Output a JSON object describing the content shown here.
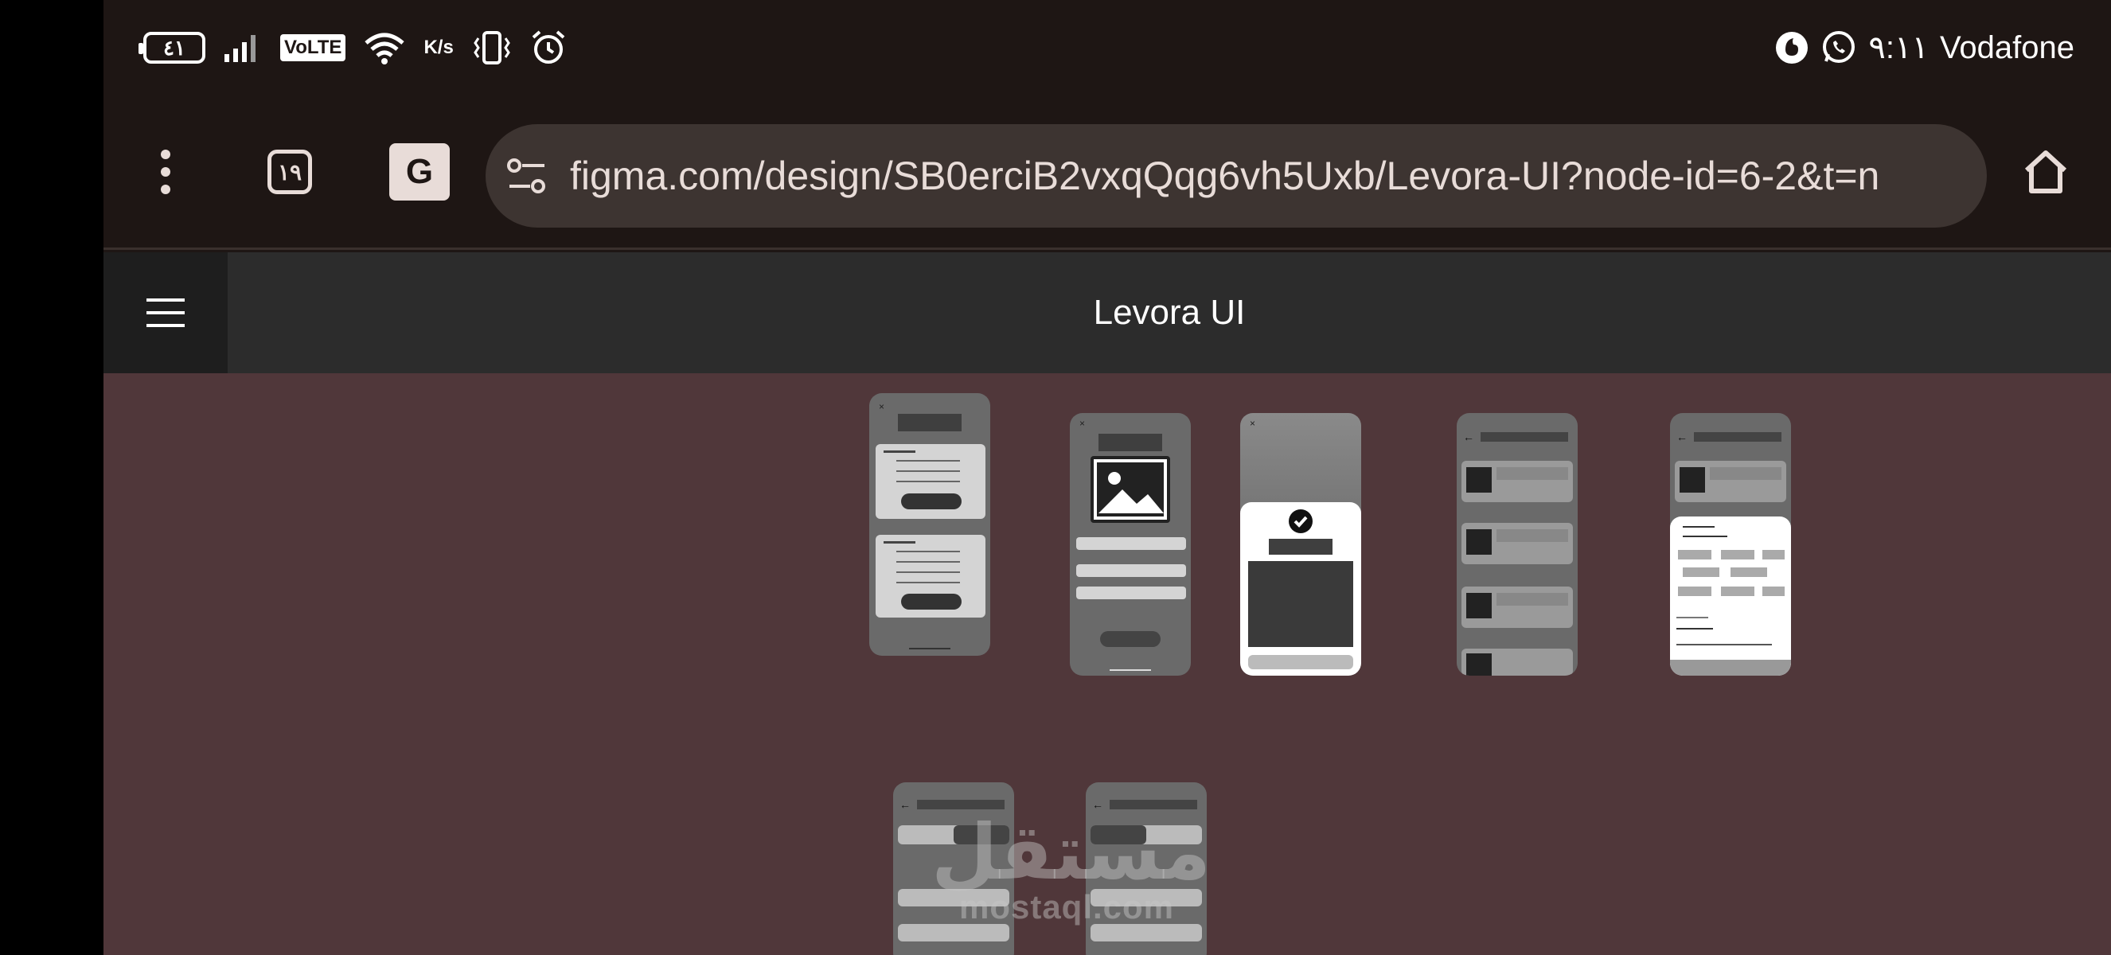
{
  "status_bar": {
    "battery": "٤١",
    "network_label": "VoLTE",
    "speed_unit": "K/s",
    "time": "٩:١١",
    "carrier": "Vodafone",
    "icons": [
      "signal-bars-icon",
      "wifi-icon",
      "vibrate-icon",
      "alarm-icon",
      "vodafone-logo-icon",
      "whatsapp-icon"
    ]
  },
  "browser": {
    "tab_count": "١٩",
    "url": "figma.com/design/SB0erciB2vxqQqg6vh5Uxb/Levora-UI?node-id=6-2&t=n",
    "icons": [
      "more-menu-icon",
      "tabs-icon",
      "translate-icon",
      "site-settings-icon",
      "home-icon"
    ]
  },
  "figma": {
    "file_title": "Levora UI",
    "menu_icon": "hamburger-menu-icon"
  },
  "watermark": {
    "arabic": "مستقل",
    "latin": "mostaql.com"
  },
  "colors": {
    "status_bg": "#1e1614",
    "url_bar_bg": "#3d3431",
    "header_bg": "#2c2c2c",
    "canvas_bg": "#50373a"
  }
}
